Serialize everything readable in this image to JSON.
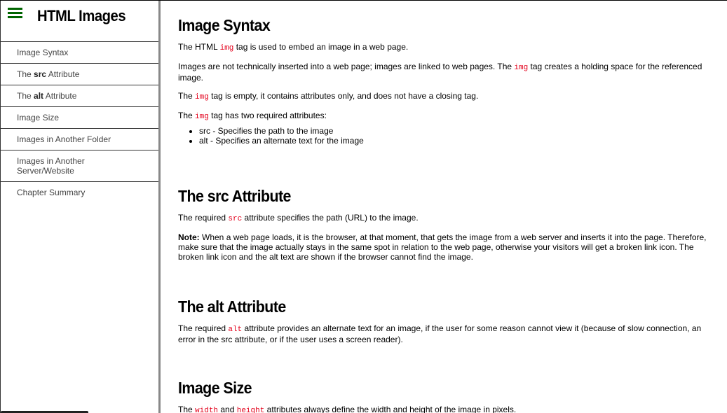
{
  "sidebar": {
    "title": "HTML Images",
    "items": [
      {
        "pre": "Image Syntax",
        "bold": "",
        "post": ""
      },
      {
        "pre": "The ",
        "bold": "src",
        "post": " Attribute"
      },
      {
        "pre": "The ",
        "bold": "alt",
        "post": " Attribute"
      },
      {
        "pre": "Image Size",
        "bold": "",
        "post": ""
      },
      {
        "pre": "Images in Another Folder",
        "bold": "",
        "post": ""
      },
      {
        "pre": "Images in Another Server/Website",
        "bold": "",
        "post": ""
      },
      {
        "pre": "Chapter Summary",
        "bold": "",
        "post": ""
      }
    ]
  },
  "icons": {
    "menu": "hamburger-menu-icon"
  },
  "colors": {
    "menu_icon": "#006400",
    "code": "#e3001b"
  },
  "sections": {
    "syntax": {
      "title": "Image Syntax",
      "p1": {
        "a": "The HTML ",
        "code": "img",
        "b": " tag is used to embed an image in a web page."
      },
      "p2": {
        "a": "Images are not technically inserted into a web page; images are linked to web pages. The ",
        "code": "img",
        "b": " tag creates a holding space for the referenced image."
      },
      "p3": {
        "a": "The ",
        "code": "img",
        "b": " tag is empty, it contains attributes only, and does not have a closing tag."
      },
      "p4": {
        "a": "The ",
        "code": "img",
        "b": " tag has two required attributes:"
      },
      "bullets": [
        "src - Specifies the path to the image",
        "alt - Specifies an alternate text for the image"
      ]
    },
    "src": {
      "title_pre": "The ",
      "title_bold": "src",
      "title_post": " Attribute",
      "p1": {
        "a": "The required ",
        "code": "src",
        "b": " attribute specifies the path (URL) to the image."
      },
      "note_label": "Note:",
      "note_text": " When a web page loads, it is the browser, at that moment, that gets the image from a web server and inserts it into the page. Therefore, make sure that the image actually stays in the same spot in relation to the web page, otherwise your visitors will get a broken link icon. The broken link icon and the alt text are shown if the browser cannot find the image."
    },
    "alt": {
      "title_pre": "The ",
      "title_bold": "alt",
      "title_post": " Attribute",
      "p1": {
        "a": "The required ",
        "code": "alt",
        "b": " attribute provides an alternate text for an image, if the user for some reason cannot view it (because of slow connection, an error in the src attribute, or if the user uses a screen reader)."
      }
    },
    "size": {
      "title": "Image Size",
      "p1": {
        "a": "The ",
        "code1": "width",
        "mid": " and ",
        "code2": "height",
        "b": " attributes always define the width and height of the image in pixels."
      }
    }
  }
}
